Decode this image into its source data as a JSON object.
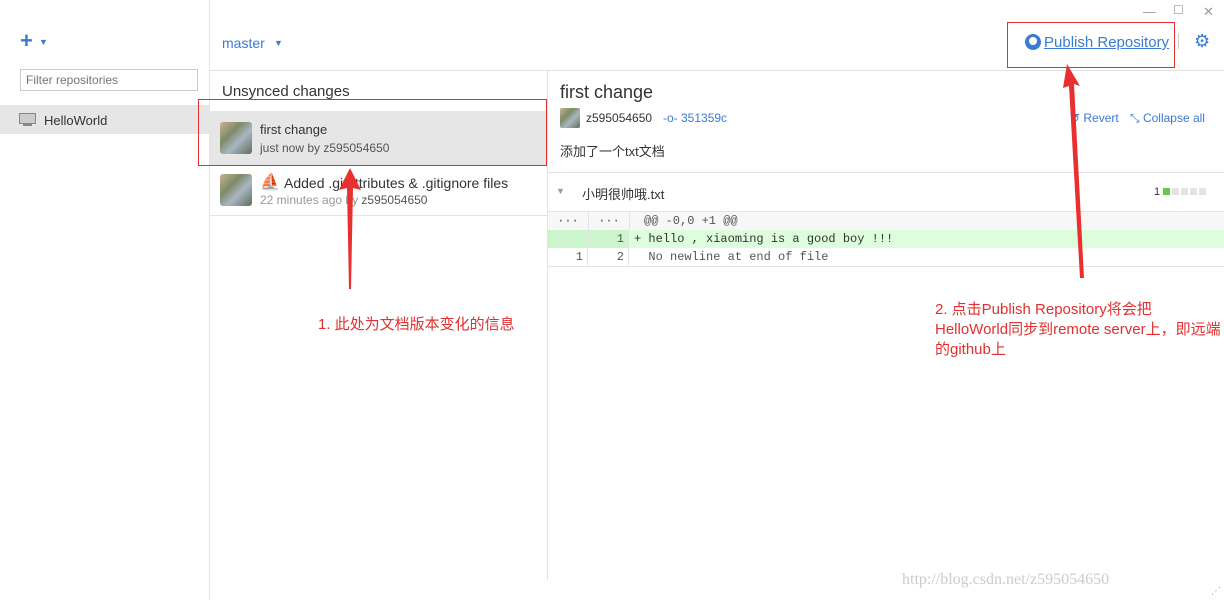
{
  "window": {
    "minimize": "—",
    "maximize": "☐",
    "close": "✕"
  },
  "sidebar": {
    "add_icon": "plus-icon",
    "add_label": "+",
    "filter_placeholder": "Filter repositories",
    "repos": [
      {
        "label": "HelloWorld",
        "icon": "monitor-icon"
      }
    ]
  },
  "toolbar": {
    "branch": "master",
    "publish_label": "Publish Repository",
    "publish_icon": "github-icon",
    "settings_icon": "gear-icon"
  },
  "history": {
    "header": "Unsynced changes",
    "commits": [
      {
        "title": "first change",
        "meta": "just now by z595054650"
      },
      {
        "title": "Added .gitattributes & .gitignore files",
        "meta_time": "22 minutes ago by",
        "meta_author": "z595054650"
      }
    ]
  },
  "commit_detail": {
    "title": "first change",
    "author": "z595054650",
    "sha": "351359c",
    "revert_label": "Revert",
    "collapse_label": "Collapse all",
    "message": "添加了一个txt文档",
    "file": {
      "name": "小明很帅哦.txt",
      "additions": "1"
    },
    "diff": [
      {
        "old": "···",
        "new": "···",
        "code": "@@ -0,0 +1 @@"
      },
      {
        "old": "",
        "new": "1",
        "code": "+ hello , xiaoming is a good boy !!!"
      },
      {
        "old": "1",
        "new": "2",
        "code": "  No newline at end of file"
      }
    ]
  },
  "annotations": {
    "note1": "1. 此处为文档版本变化的信息",
    "note2": "2. 点击Publish Repository将会把HelloWorld同步到remote server上，即远端的github上",
    "watermark": "http://blog.csdn.net/z595054650"
  }
}
